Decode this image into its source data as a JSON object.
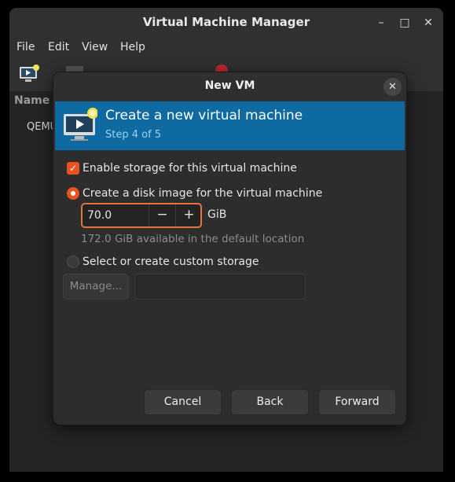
{
  "app": {
    "title": "Virtual Machine Manager",
    "window_controls": {
      "minimize": "–",
      "maximize": "□",
      "close": "✕"
    }
  },
  "menubar": {
    "items": [
      "File",
      "Edit",
      "View",
      "Help"
    ]
  },
  "list": {
    "column_header": "Name",
    "row_text": "QEMU"
  },
  "dialog": {
    "title": "New VM",
    "close_glyph": "✕",
    "banner": {
      "heading": "Create a new virtual machine",
      "step": "Step 4 of 5",
      "icon": "monitor-icon",
      "color": "#0e6aa0"
    },
    "enable_storage": {
      "label": "Enable storage for this virtual machine",
      "checked": true
    },
    "create_disk": {
      "label": "Create a disk image for the virtual machine",
      "selected": true
    },
    "disk_size": {
      "value": "70.0",
      "unit": "GiB",
      "minus": "−",
      "plus": "+"
    },
    "available_hint": "172.0 GiB available in the default location",
    "custom_storage": {
      "label": "Select or create custom storage",
      "selected": false
    },
    "manage_label": "Manage...",
    "custom_path": "",
    "buttons": {
      "cancel": "Cancel",
      "back": "Back",
      "forward": "Forward"
    },
    "accent_color": "#e9531d"
  }
}
